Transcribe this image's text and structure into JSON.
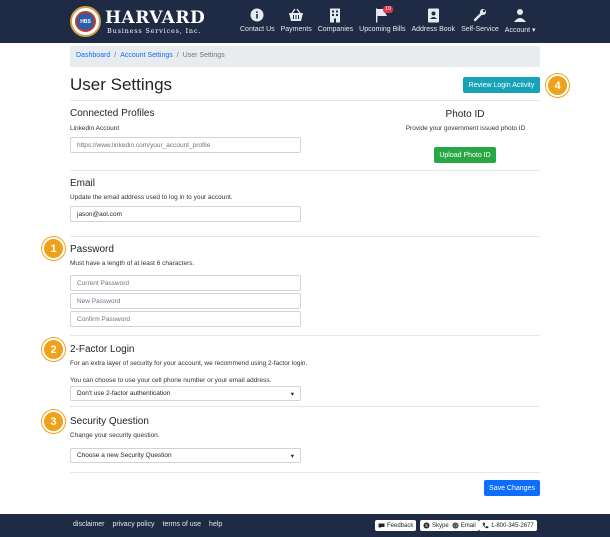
{
  "brand": {
    "name": "Harvard",
    "subtitle": "Business Services, Inc.",
    "seal_text": "HBS"
  },
  "nav": [
    {
      "label": "Contact Us",
      "icon": "info-icon"
    },
    {
      "label": "Payments",
      "icon": "basket-icon"
    },
    {
      "label": "Companies",
      "icon": "building-icon"
    },
    {
      "label": "Upcoming Bills",
      "icon": "flag-icon",
      "badge": "10"
    },
    {
      "label": "Address Book",
      "icon": "address-book-icon"
    },
    {
      "label": "Self-Service",
      "icon": "wrench-icon"
    },
    {
      "label": "Account",
      "icon": "user-icon"
    }
  ],
  "breadcrumb": {
    "items": [
      "Dashboard",
      "Account Settings",
      "User Settings"
    ]
  },
  "page": {
    "title": "User Settings",
    "review_button": "Review Login Activity",
    "save_button": "Save Changes"
  },
  "connected_profiles": {
    "heading": "Connected Profiles",
    "linkedin_label": "Linkedin Account",
    "linkedin_placeholder": "https://www.linkedin.com/your_account_profile"
  },
  "photo_id": {
    "heading": "Photo ID",
    "description": "Provide your government issued photo ID",
    "button": "Upload Photo ID"
  },
  "email": {
    "heading": "Email",
    "description": "Update the email address used to log in to your account.",
    "value": "jason@aol.com"
  },
  "password": {
    "heading": "Password",
    "description": "Must have a length of at least 6 characters.",
    "current_placeholder": "Current Password",
    "new_placeholder": "New Password",
    "confirm_placeholder": "Confirm Password"
  },
  "two_factor": {
    "heading": "2-Factor Login",
    "description": "For an extra layer of security for your account, we recommend using 2-factor login.",
    "description2": "You can choose to use your cell phone number or your email address.",
    "selected": "Don't use 2-factor authentication"
  },
  "security_question": {
    "heading": "Security Question",
    "description": "Change your security question.",
    "selected": "Choose a new Security Question"
  },
  "markers": [
    "1",
    "2",
    "3",
    "4"
  ],
  "footer": {
    "links": [
      "disclaimer",
      "privacy policy",
      "terms of use",
      "help"
    ],
    "feedback": "Feedback",
    "skype": "Skype",
    "email": "Email",
    "phone": "1-800-345-2677"
  },
  "colors": {
    "navbar": "#1f2a44",
    "accent_info": "#17a2b8",
    "accent_success": "#28a745",
    "accent_primary": "#0d6efd",
    "marker": "#f0a11a"
  }
}
